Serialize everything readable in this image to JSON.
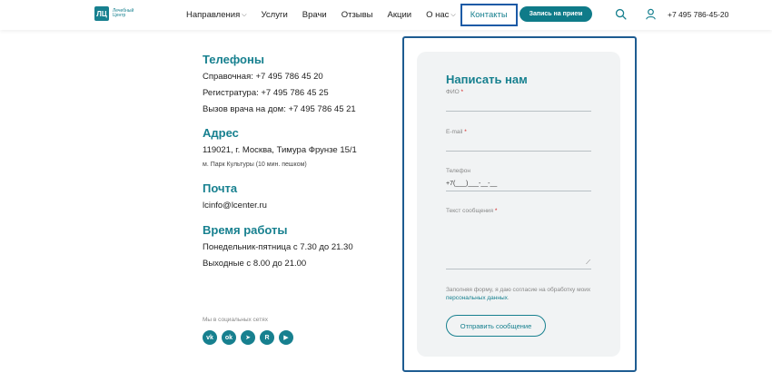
{
  "header": {
    "logo_mark": "ЛЦ",
    "logo_text": "Лечебный Центр",
    "nav": [
      {
        "label": "Направления",
        "has_dropdown": true
      },
      {
        "label": "Услуги",
        "has_dropdown": false
      },
      {
        "label": "Врачи",
        "has_dropdown": false
      },
      {
        "label": "Отзывы",
        "has_dropdown": false
      },
      {
        "label": "Акции",
        "has_dropdown": false
      },
      {
        "label": "О нас",
        "has_dropdown": true
      },
      {
        "label": "Контакты",
        "has_dropdown": false,
        "active": true
      }
    ],
    "cta_label": "Запись на прием",
    "phone": "+7 495 786-45-20",
    "icons": [
      "search-icon",
      "user-icon"
    ]
  },
  "contacts": {
    "phones_title": "Телефоны",
    "phones": [
      "Справочная: +7 495 786 45 20",
      "Регистратура: +7 495 786 45 25",
      "Вызов врача на дом: +7 495 786 45 21"
    ],
    "address_title": "Адрес",
    "address": "119021, г. Москва, Тимура Фрунзе 15/1",
    "metro": "м. Парк Культуры (10 мин. пешком)",
    "mail_title": "Почта",
    "email": "lcinfo@lcenter.ru",
    "hours_title": "Время работы",
    "hours": [
      "Понедельник-пятница с 7.30 до 21.30",
      "Выходные с 8.00 до 21.00"
    ],
    "social_label": "Мы в социальных сетях",
    "social": [
      {
        "icon": "vk-icon",
        "glyph": "vk"
      },
      {
        "icon": "odnoklassniki-icon",
        "glyph": "ok"
      },
      {
        "icon": "telegram-icon",
        "glyph": "➤"
      },
      {
        "icon": "rutube-icon",
        "glyph": "R"
      },
      {
        "icon": "youtube-icon",
        "glyph": "▶"
      }
    ]
  },
  "form": {
    "title": "Написать нам",
    "fio_label": "ФИО",
    "email_label": "E-mail",
    "phone_label": "Телефон",
    "phone_value": "+7(___)___-__-__",
    "message_label": "Текст сообщения",
    "required_mark": "*",
    "consent_text": "Заполняя форму, я даю согласие на обработку моих ",
    "consent_link": "персональных данных",
    "consent_end": ".",
    "submit_label": "Отправить сообщение"
  },
  "colors": {
    "accent": "#17808f",
    "button": "#0f7b89",
    "highlight_border": "#1e5c91",
    "required": "#d42020"
  }
}
